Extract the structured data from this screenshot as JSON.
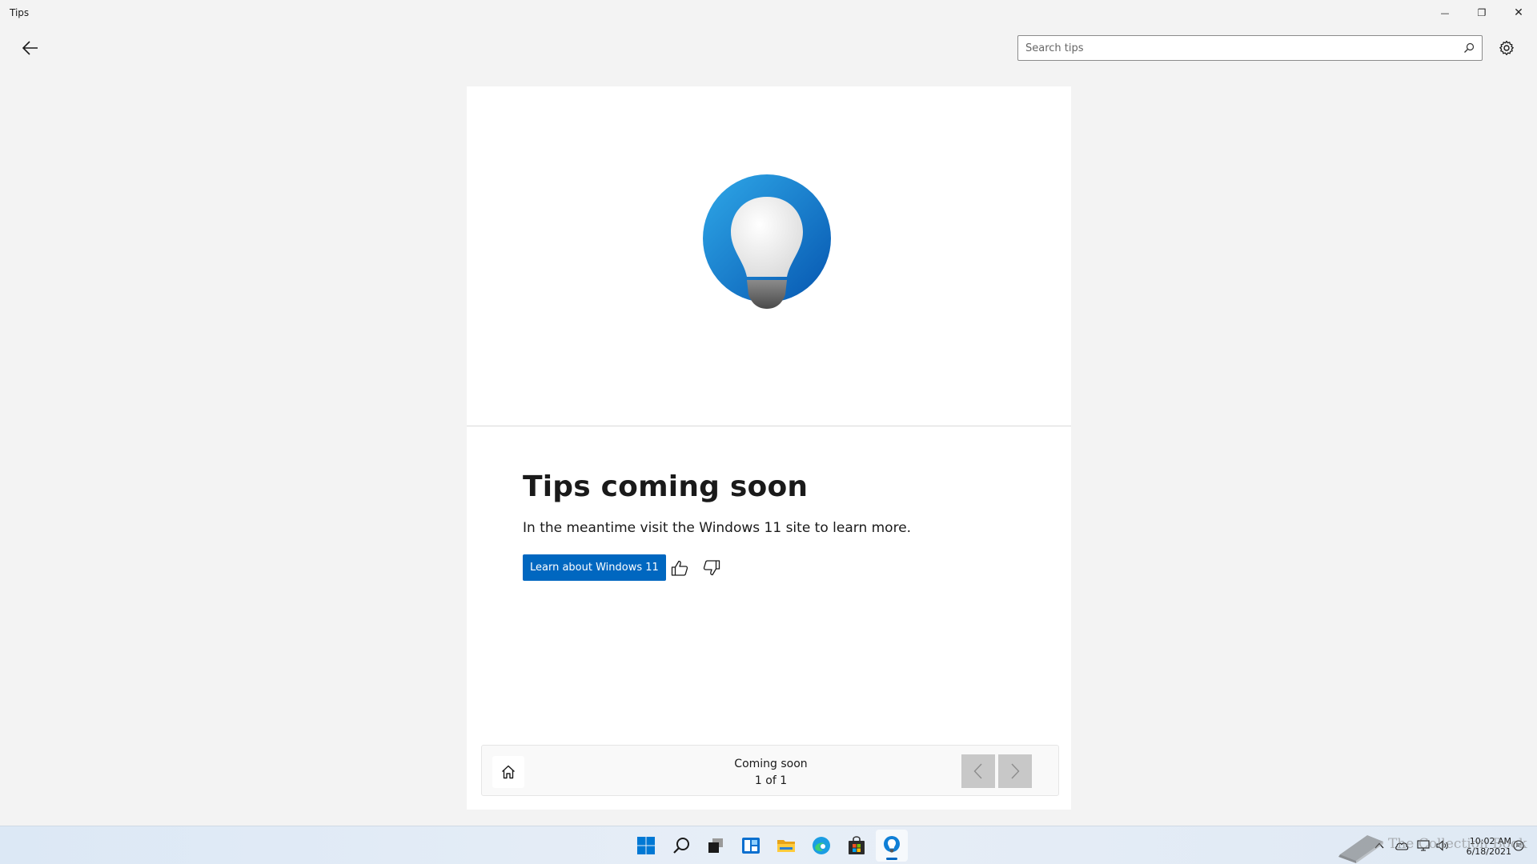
{
  "window": {
    "title": "Tips",
    "minimize_glyph": "—",
    "maximize_glyph": "❐",
    "close_glyph": "✕"
  },
  "header": {
    "back_icon": "back-arrow-icon",
    "search": {
      "placeholder": "Search tips",
      "value": ""
    },
    "settings_icon": "gear-icon"
  },
  "tip": {
    "hero_icon": "tips-lightbulb-logo",
    "title": "Tips coming soon",
    "description": "In the meantime visit the Windows 11 site to learn more.",
    "cta_label": "Learn about Windows 11",
    "feedback": {
      "like_icon": "thumbs-up-icon",
      "dislike_icon": "thumbs-down-icon"
    }
  },
  "navigation": {
    "home_icon": "home-icon",
    "collection": "Coming soon",
    "position": "1 of 1",
    "prev_icon": "chevron-left-icon",
    "next_icon": "chevron-right-icon"
  },
  "taskbar": {
    "apps": [
      {
        "name": "start",
        "icon": "windows-start-icon"
      },
      {
        "name": "search",
        "icon": "search-icon"
      },
      {
        "name": "task-view",
        "icon": "task-view-icon"
      },
      {
        "name": "widgets",
        "icon": "widgets-icon"
      },
      {
        "name": "file-explorer",
        "icon": "folder-icon"
      },
      {
        "name": "edge",
        "icon": "edge-browser-icon"
      },
      {
        "name": "store",
        "icon": "store-bag-icon"
      },
      {
        "name": "tips",
        "icon": "tips-lightbulb-icon",
        "active": true
      }
    ],
    "tray": {
      "chevron_icon": "chevron-up-icon",
      "onedrive_icon": "cloud-icon",
      "network_icon": "monitor-network-icon",
      "volume_icon": "speaker-icon",
      "notification_icon": "notification-icon"
    },
    "clock": {
      "time": "10:02 AM",
      "date": "6/18/2021"
    }
  },
  "watermark": {
    "text": "The Collection Book",
    "icon": "book-logo"
  },
  "colors": {
    "accent": "#0067c0",
    "window_bg": "#f3f3f3",
    "card_bg": "#ffffff",
    "nav_button_disabled": "#c8c8c8"
  }
}
